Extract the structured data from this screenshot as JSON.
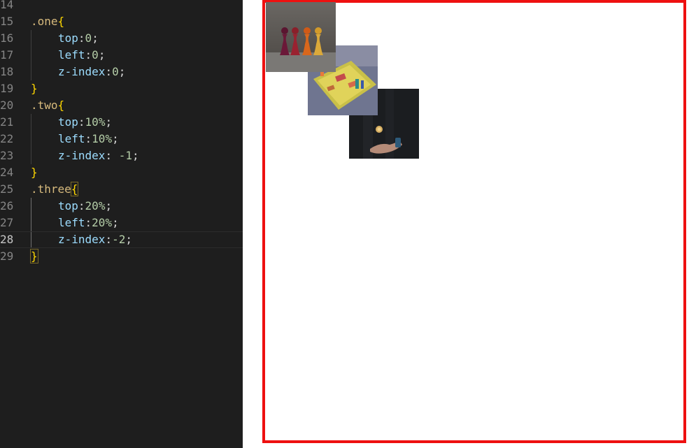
{
  "editor": {
    "lines": [
      {
        "no": "14",
        "text": ""
      },
      {
        "no": "15",
        "sel": ".one",
        "brace": "{"
      },
      {
        "no": "16",
        "prop": "top",
        "sep": ":",
        "value": "0",
        "end": ";"
      },
      {
        "no": "17",
        "prop": "left",
        "sep": ":",
        "value": "0",
        "end": ";"
      },
      {
        "no": "18",
        "prop": "z-index",
        "sep": ":",
        "value": "0",
        "end": ";"
      },
      {
        "no": "19",
        "brace": "}"
      },
      {
        "no": "20",
        "sel": ".two",
        "brace": "{"
      },
      {
        "no": "21",
        "prop": "top",
        "sep": ":",
        "value": "10%",
        "end": ";"
      },
      {
        "no": "22",
        "prop": "left",
        "sep": ":",
        "value": "10%",
        "end": ";"
      },
      {
        "no": "23",
        "prop": "z-index",
        "sep": ": ",
        "value": "-1",
        "end": ";"
      },
      {
        "no": "24",
        "brace": "}"
      },
      {
        "no": "25",
        "sel": ".three",
        "brace": "{"
      },
      {
        "no": "26",
        "prop": "top",
        "sep": ":",
        "value": "20%",
        "end": ";"
      },
      {
        "no": "27",
        "prop": "left",
        "sep": ":",
        "value": "20%",
        "end": ";"
      },
      {
        "no": "28",
        "prop": "z-index",
        "sep": ":",
        "value": "-2",
        "end": ";"
      },
      {
        "no": "29",
        "brace": "}"
      }
    ],
    "active_line": "28"
  },
  "preview": {
    "border_color": "#ee1010",
    "images": [
      {
        "name": "pawns-photo",
        "subject": "colored game pawns on a table"
      },
      {
        "name": "board-game-photo",
        "subject": "yellow board game with pieces"
      },
      {
        "name": "dice-hand-photo",
        "subject": "hand tossing a die in the dark"
      }
    ]
  },
  "colors": {
    "editor_bg": "#1e1e1e",
    "selector": "#d7ba7d",
    "brace": "#ffd700",
    "property": "#9cdcfe",
    "number": "#b5cea8",
    "line_number": "#858585"
  }
}
